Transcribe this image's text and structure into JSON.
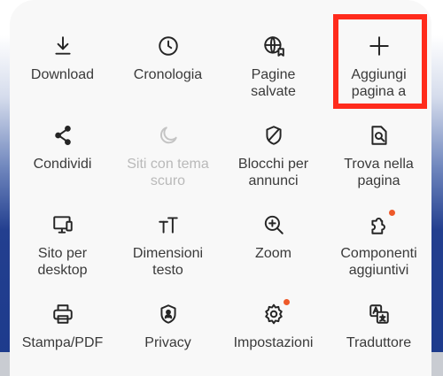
{
  "menu": {
    "items": [
      {
        "label": "Download",
        "icon": "download-icon"
      },
      {
        "label": "Cronologia",
        "icon": "clock-icon"
      },
      {
        "label": "Pagine\nsalvate",
        "icon": "saved-pages-icon"
      },
      {
        "label": "Aggiungi\npagina a",
        "icon": "plus-icon"
      },
      {
        "label": "Condividi",
        "icon": "share-icon"
      },
      {
        "label": "Siti con tema\nscuro",
        "icon": "moon-icon",
        "disabled": true
      },
      {
        "label": "Blocchi per\nannunci",
        "icon": "shield-icon"
      },
      {
        "label": "Trova nella\npagina",
        "icon": "find-in-page-icon"
      },
      {
        "label": "Sito per\ndesktop",
        "icon": "desktop-icon"
      },
      {
        "label": "Dimensioni\ntesto",
        "icon": "text-size-icon"
      },
      {
        "label": "Zoom",
        "icon": "zoom-icon"
      },
      {
        "label": "Componenti\naggiuntivi",
        "icon": "puzzle-icon",
        "badge": true
      },
      {
        "label": "Stampa/PDF",
        "icon": "printer-icon"
      },
      {
        "label": "Privacy",
        "icon": "privacy-icon"
      },
      {
        "label": "Impostazioni",
        "icon": "gear-icon",
        "badge": true
      },
      {
        "label": "Traduttore",
        "icon": "translate-icon"
      }
    ]
  },
  "colors": {
    "highlight_border": "#ff2b1c",
    "badge": "#ee5a2a",
    "panel_bg": "#f8f8f8",
    "disabled_text": "#b9b9b9"
  }
}
